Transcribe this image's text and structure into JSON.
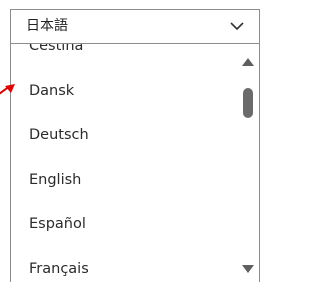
{
  "select": {
    "current_value": "日本語",
    "chevron_icon": "chevron-down-icon"
  },
  "options": [
    "Čeština",
    "Dansk",
    "Deutsch",
    "English",
    "Español",
    "Français"
  ],
  "scrollbar": {
    "up_icon": "arrow-up-icon",
    "down_icon": "arrow-down-icon"
  },
  "colors": {
    "border": "#8c8c8c",
    "text": "#2b2b2b",
    "scroll_thumb": "#6b6b6b",
    "pointer": "#e00000"
  }
}
